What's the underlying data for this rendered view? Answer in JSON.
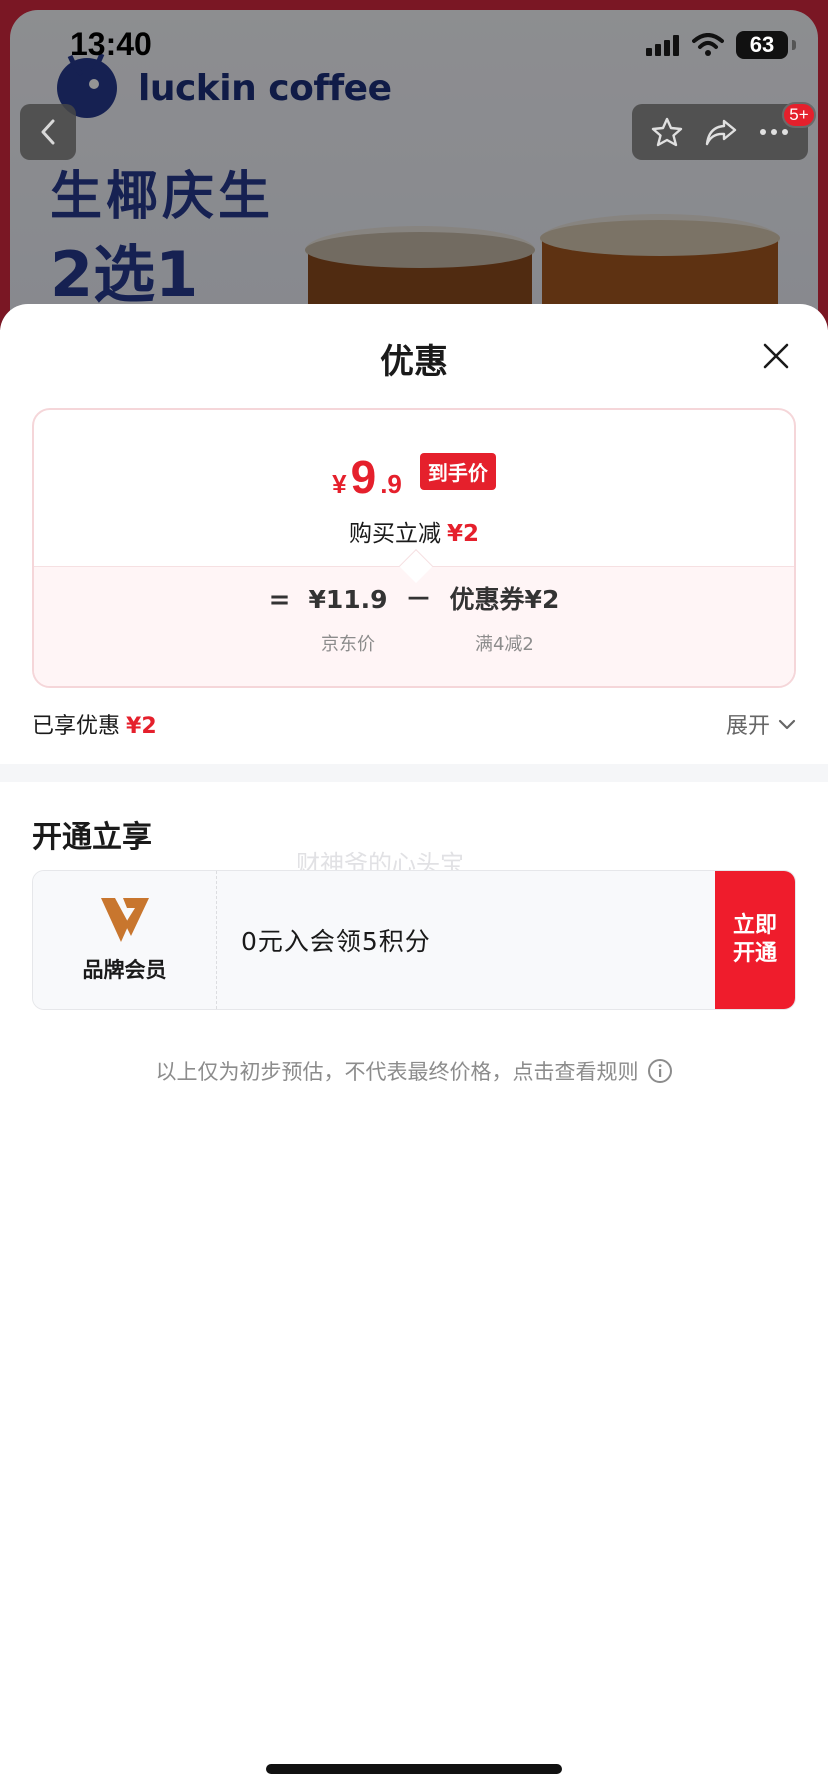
{
  "status_bar": {
    "time": "13:40",
    "battery": "63",
    "icons": [
      "signal-icon",
      "wifi-icon",
      "battery-icon"
    ]
  },
  "background_page": {
    "brand": "luckin coffee",
    "promo_line1": "生椰庆生",
    "promo_line2": "2选1",
    "cart_badge": "5+",
    "icons": [
      "back-arrow-icon",
      "star-icon",
      "share-icon",
      "more-icon"
    ]
  },
  "sheet": {
    "title": "优惠",
    "price_card": {
      "currency": "¥",
      "final_price_int": "9",
      "final_price_dec": ".9",
      "final_tag": "到手价",
      "instant_label": "购买立减",
      "instant_value": "¥2",
      "formula": {
        "eq": "=",
        "jd_price": "¥11.9",
        "jd_label": "京东价",
        "minus": "－",
        "coupon": "优惠券¥2",
        "coupon_rule": "满4减2"
      }
    },
    "saved": {
      "label": "已享优惠",
      "value": "¥2",
      "expand_label": "展开"
    },
    "membership": {
      "section_title": "开通立享",
      "watermark": "财神爷的心头宝",
      "brand_label": "品牌会员",
      "offer_text": "0元入会领5积分",
      "join_line1": "立即",
      "join_line2": "开通"
    },
    "disclaimer": "以上仅为初步预估，不代表最终价格，点击查看规则"
  },
  "colors": {
    "accent_red": "#e5202c",
    "brand_blue": "#26398e",
    "member_orange": "#c8762e"
  }
}
